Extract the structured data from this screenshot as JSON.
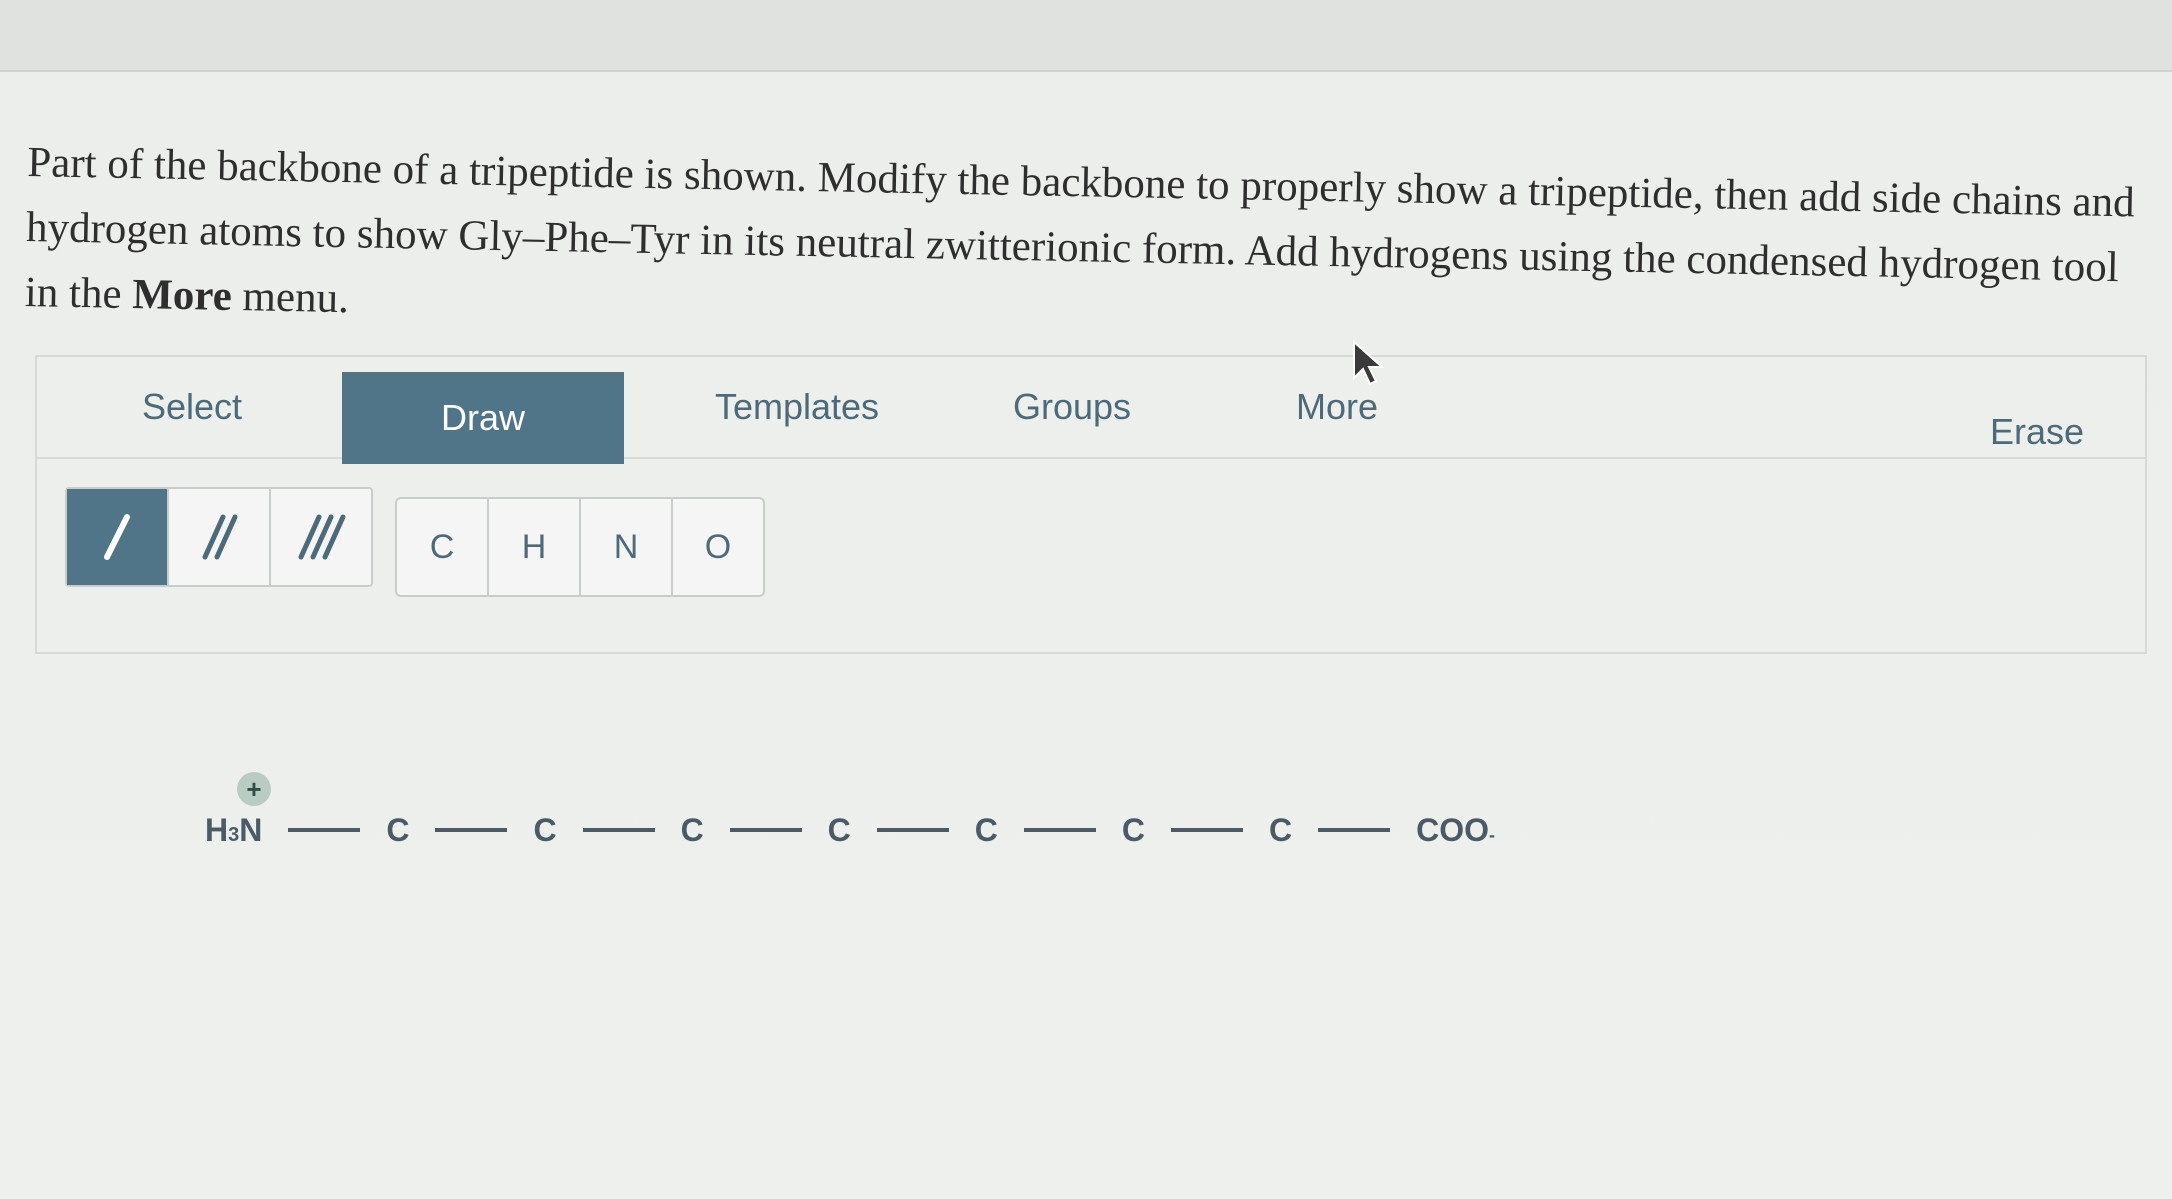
{
  "question": {
    "part1": "Part of the backbone of a tripeptide is shown. Modify the backbone to properly show a tripeptide, then add side chains and hydrogen atoms to show Gly–Phe–Tyr in its neutral zwitterionic form. Add hydrogens using the condensed hydrogen tool in the ",
    "bold_word": "More",
    "part2": " menu."
  },
  "tabs": {
    "select": "Select",
    "draw": "Draw",
    "templates": "Templates",
    "groups": "Groups",
    "more": "More",
    "erase": "Erase"
  },
  "bond_tools": [
    {
      "label": "/",
      "icon": "single-bond-icon"
    },
    {
      "label": "//",
      "icon": "double-bond-icon"
    },
    {
      "label": "///",
      "icon": "triple-bond-icon"
    }
  ],
  "atom_tools": [
    "C",
    "H",
    "N",
    "O"
  ],
  "molecule": {
    "n_terminus": "H",
    "n_terminus_sub": "3",
    "n_terminus_atom": "N",
    "n_charge": "+",
    "carbons": [
      "C",
      "C",
      "C",
      "C",
      "C",
      "C",
      "C"
    ],
    "c_terminus": "COO",
    "c_charge": "-"
  },
  "colors": {
    "accent": "#507589",
    "tab_text": "#4d6a7a",
    "bond": "#4a5a66"
  }
}
